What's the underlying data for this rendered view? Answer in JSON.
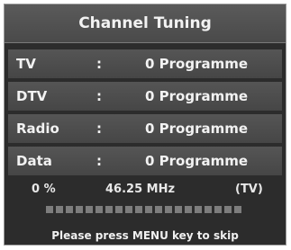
{
  "title": "Channel Tuning",
  "rows": [
    {
      "name": "TV",
      "colon": ":",
      "value": "0 Programme"
    },
    {
      "name": "DTV",
      "colon": ":",
      "value": "0 Programme"
    },
    {
      "name": "Radio",
      "colon": ":",
      "value": "0 Programme"
    },
    {
      "name": "Data",
      "colon": ":",
      "value": "0 Programme"
    }
  ],
  "status": {
    "percent": "0  %",
    "frequency": "46.25 MHz",
    "band": "(TV)"
  },
  "progress": {
    "fraction": 0,
    "segments": 20
  },
  "hint": "Please press MENU key to skip",
  "colors": {
    "panel": "#2c2c2c",
    "row": "#4f4f4f",
    "text": "#f2f2f2"
  }
}
